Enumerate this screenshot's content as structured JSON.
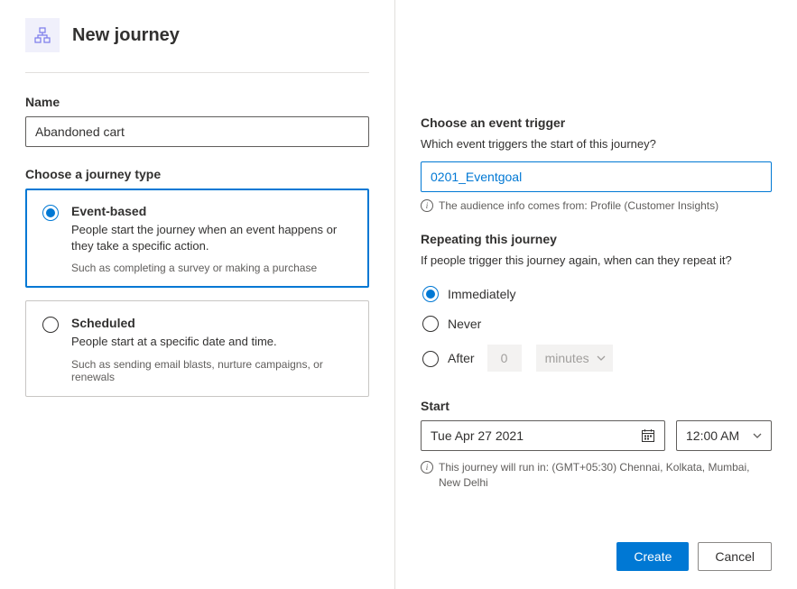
{
  "header": {
    "title": "New journey"
  },
  "name": {
    "label": "Name",
    "value": "Abandoned cart"
  },
  "journeyType": {
    "label": "Choose a journey type",
    "eventBased": {
      "title": "Event-based",
      "desc": "People start the journey when an event happens or they take a specific action.",
      "hint": "Such as completing a survey or making a purchase"
    },
    "scheduled": {
      "title": "Scheduled",
      "desc": "People start at a specific date and time.",
      "hint": "Such as sending email blasts, nurture campaigns, or renewals"
    }
  },
  "trigger": {
    "label": "Choose an event trigger",
    "subtext": "Which event triggers the start of this journey?",
    "value": "0201_Eventgoal",
    "info": "The audience info comes from: Profile (Customer Insights)"
  },
  "repeat": {
    "label": "Repeating this journey",
    "subtext": "If people trigger this journey again, when can they repeat it?",
    "options": {
      "immediately": "Immediately",
      "never": "Never",
      "after": "After",
      "afterValue": "0",
      "afterUnit": "minutes"
    }
  },
  "start": {
    "label": "Start",
    "date": "Tue Apr 27 2021",
    "time": "12:00 AM",
    "info": "This journey will run in: (GMT+05:30) Chennai, Kolkata, Mumbai, New Delhi"
  },
  "buttons": {
    "create": "Create",
    "cancel": "Cancel"
  }
}
